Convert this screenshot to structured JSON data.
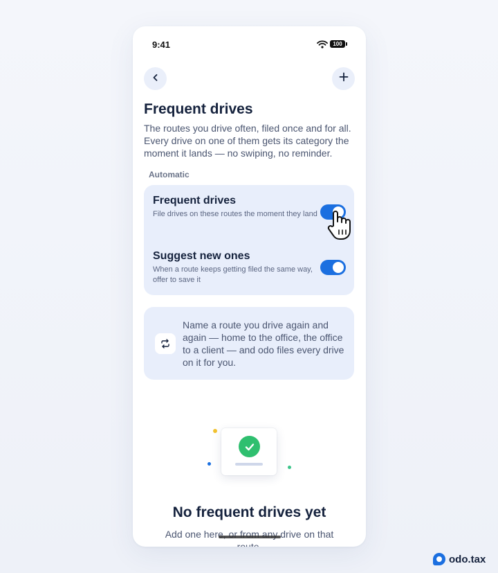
{
  "status_bar": {
    "time": "9:41",
    "battery": "100"
  },
  "header": {
    "title": "Frequent drives",
    "description": "The routes you drive often, filed once and for all. Every drive on one of them gets its category the moment it lands — no swiping, no reminder."
  },
  "section": {
    "label": "Automatic"
  },
  "settings": [
    {
      "title": "Frequent drives",
      "subtitle": "File drives on these routes the moment they land",
      "enabled": true
    },
    {
      "title": "Suggest new ones",
      "subtitle": "When a route keeps getting filed the same way, offer to save it",
      "enabled": true
    }
  ],
  "info": {
    "text": "Name a route you drive again and again — home to the office, the office to a client — and odo files every drive on it for you."
  },
  "empty_state": {
    "title": "No frequent drives yet",
    "subtitle": "Add one here, or from any drive on that route."
  },
  "brand": {
    "name": "odo.tax"
  },
  "colors": {
    "accent": "#1b6fe0",
    "card": "#e8eefb",
    "success": "#2fbf6f"
  },
  "icons": [
    "back-icon",
    "plus-icon",
    "wifi-icon",
    "repeat-icon",
    "check-icon",
    "hand-cursor-icon",
    "odo-logo-icon"
  ]
}
